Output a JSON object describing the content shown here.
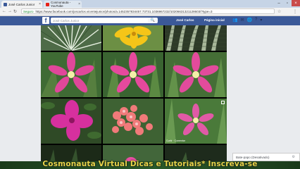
{
  "browser": {
    "tabs": [
      {
        "label": "José Carlos Junior",
        "active": true,
        "icon": "facebook-icon"
      },
      {
        "label": "Cosmonauta - YouTube",
        "active": false,
        "icon": "youtube-icon"
      }
    ],
    "secure_label": "Seguro",
    "url": "https://www.facebook.com/joscarlos.vicentejunior/photos/a.1452357834457.73731.1036967232/10206631321128603/?type=3"
  },
  "facebook": {
    "search_placeholder": "José Carlos Junior",
    "profile_link": "José Carlos",
    "home_link": "Página inicial",
    "brand_color": "#3b5998"
  },
  "photos": [
    {
      "subject": "variegated-grass"
    },
    {
      "subject": "yellow-lily"
    },
    {
      "subject": "striped-plant"
    },
    {
      "subject": "pink-rain-lily"
    },
    {
      "subject": "pink-rain-lily"
    },
    {
      "subject": "pink-rain-lily"
    },
    {
      "subject": "magenta-azalea"
    },
    {
      "subject": "red-flower-cluster"
    },
    {
      "subject": "pink-rain-lily",
      "caption": "Curtir · Comentar"
    }
  ],
  "chat": {
    "status": "Bate-papo (Desativado)"
  },
  "watermark": {
    "text": "Cosmonauta Virtual Dicas e Tutoriais* Inscreva-se"
  }
}
